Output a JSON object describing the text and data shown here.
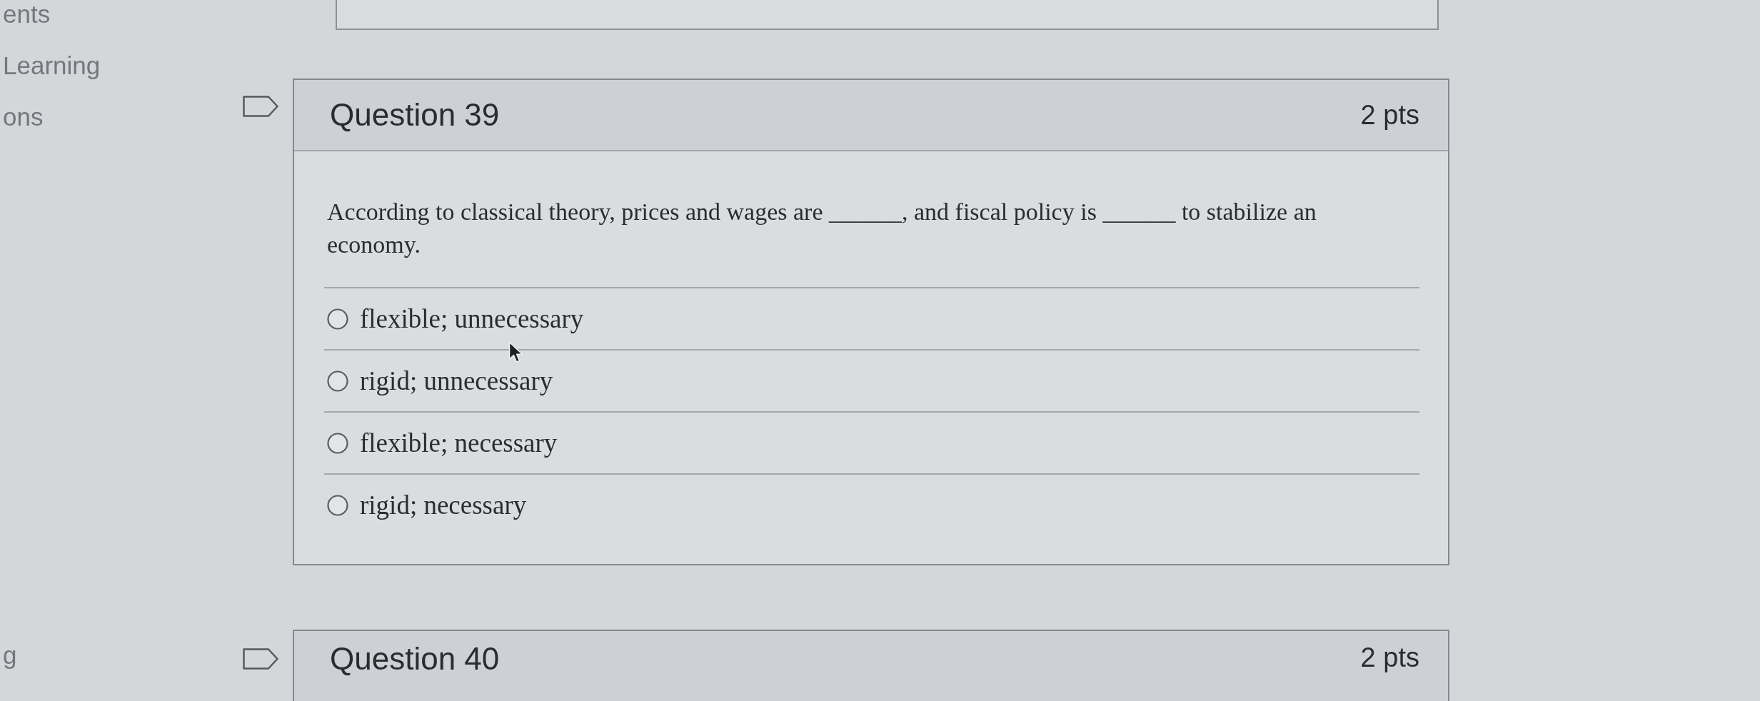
{
  "sidebar": {
    "items": [
      {
        "label": "ents"
      },
      {
        "label": "Learning"
      },
      {
        "label": "ons"
      },
      {
        "label": "g"
      }
    ]
  },
  "questions": [
    {
      "title": "Question 39",
      "points": "2 pts",
      "flagged": false,
      "text": "According to classical theory, prices and wages are ______, and fiscal policy is ______ to stabilize an economy.",
      "answers": [
        {
          "label": "flexible; unnecessary",
          "selected": false
        },
        {
          "label": "rigid; unnecessary",
          "selected": false
        },
        {
          "label": "flexible; necessary",
          "selected": false
        },
        {
          "label": "rigid; necessary",
          "selected": false
        }
      ]
    },
    {
      "title": "Question 40",
      "points": "2 pts",
      "flagged": false
    }
  ]
}
